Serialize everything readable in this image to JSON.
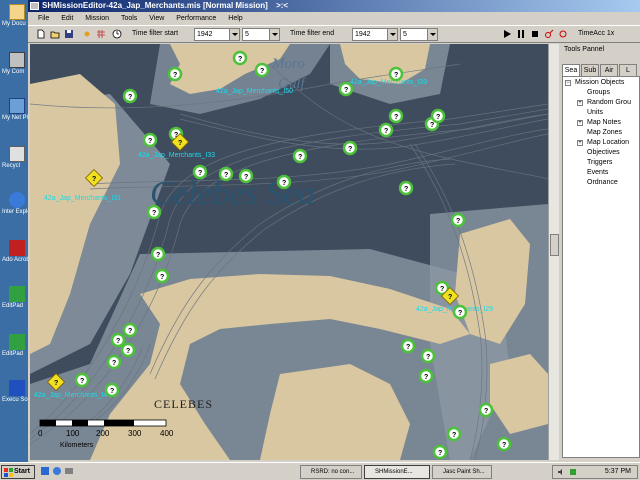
{
  "window": {
    "title": "SHMissionEditor-42a_Jap_Merchants.mis [Normal Mission]",
    "title_suffix": ">:<"
  },
  "menu": [
    "File",
    "Edit",
    "Mission",
    "Tools",
    "View",
    "Performance",
    "Help"
  ],
  "toolbar": {
    "time_filter_start_label": "Time filter start",
    "time_filter_end_label": "Time filter end",
    "start_year": "1942",
    "start_month": "5",
    "end_year": "1942",
    "end_month": "5",
    "time_acc": "TimeAcc 1x"
  },
  "panel": {
    "title": "Tools Pannel",
    "tabs": [
      "Sea",
      "Sub",
      "Air",
      "L"
    ],
    "tree": {
      "root": "Mission Objects",
      "children": [
        "Groups",
        "Random Grou",
        "Units",
        "Map Notes",
        "Map Zones",
        "Map Location",
        "Objectives",
        "Triggers",
        "Events",
        "Ordnance"
      ]
    }
  },
  "map": {
    "sea_name": "Celebes Sea",
    "gulf_name_1": "Moro",
    "gulf_name_2": "Gulf",
    "land_name": "CELEBES",
    "scale": {
      "ticks": [
        "0",
        "100",
        "200",
        "300",
        "400"
      ],
      "unit": "Kilometers"
    },
    "unit_labels": [
      "42a_Jap_Merchants_I50",
      "42a_Jap_Merchants_I39",
      "42a_Jap_Merchants_I33",
      "42a_Jap_Merchants_I31",
      "42a_Jap_Merchants_I29",
      "42a_Jap_Merchants_I4"
    ],
    "marker_symbol": "?"
  },
  "desktop": {
    "icons": [
      "My Docu",
      "My Com",
      "My Net Plac",
      "Recycl",
      "Inter Explo",
      "Ado Acroba",
      "EditPad",
      "EditPad",
      "Execu Softw"
    ]
  },
  "taskbar": {
    "start_label": "Start",
    "tasks": [
      "RSRD: no con...",
      "SHMissionE...",
      "Jasc Paint Sh..."
    ],
    "clock": "5:37 PM"
  },
  "colors": {
    "sea": "#3f4c5d",
    "land": "#d8c7a0",
    "shallow": "#8e9aa6",
    "marker_ring": "#4cc23a",
    "label_cyan": "#20d8e8",
    "selected_marker": "#f0e020"
  }
}
